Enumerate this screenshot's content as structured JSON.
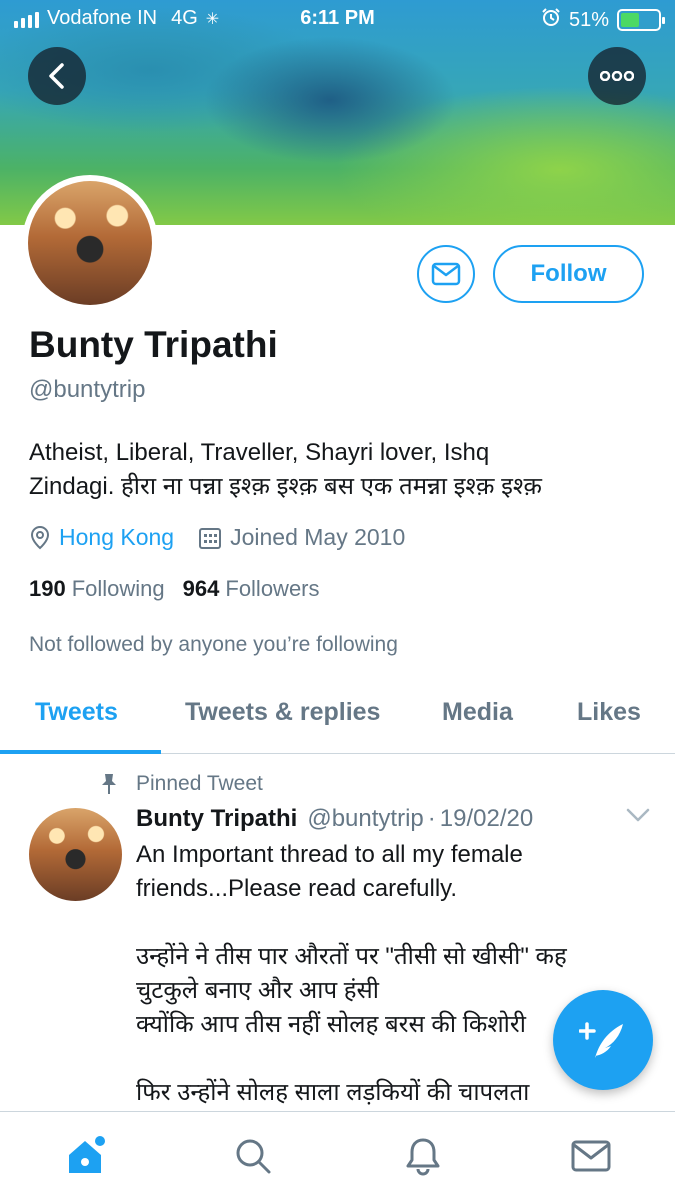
{
  "status_bar": {
    "carrier": "Vodafone IN",
    "network": "4G",
    "time": "6:11 PM",
    "battery": "51%",
    "battery_level": 0.51
  },
  "profile": {
    "name": "Bunty Tripathi",
    "handle": "@buntytrip",
    "bio_line1": "Atheist, Liberal, Traveller, Shayri lover, Ishq",
    "bio_line2": "Zindagi. हीरा ना पन्ना इश्क़ इश्क़ बस एक तमन्ना इश्क़ इश्क़",
    "location": "Hong Kong",
    "joined": "Joined May 2010",
    "following_count": "190",
    "following_label": "Following",
    "followers_count": "964",
    "followers_label": "Followers",
    "not_followed": "Not followed by anyone you’re following",
    "follow_label": "Follow"
  },
  "tabs": [
    {
      "label": "Tweets",
      "active": true
    },
    {
      "label": "Tweets & replies",
      "active": false
    },
    {
      "label": "Media",
      "active": false
    },
    {
      "label": "Likes",
      "active": false
    }
  ],
  "pinned_tweet": {
    "pinned_label": "Pinned Tweet",
    "name": "Bunty Tripathi",
    "handle": "@buntytrip",
    "separator": "·",
    "date": "19/02/20",
    "lines": [
      "An Important thread to all my female",
      "friends...Please read carefully.",
      "",
      "उन्होंने ने तीस पार औरतों पर \"तीसी सो खीसी\" कह",
      "चुटकुले बनाए और आप हंसी",
      "क्योंकि आप तीस नहीं सोलह बरस की किशोरी",
      "",
      "फिर उन्होंने सोलह साला लड़कियों की चापलता"
    ]
  },
  "colors": {
    "accent": "#1da1f2",
    "secondary_text": "#657786",
    "primary_text": "#14171a"
  },
  "icons": {
    "back": "chevron-left-icon",
    "more": "more-horizontal-icon",
    "message": "envelope-icon",
    "location": "location-pin-icon",
    "calendar": "calendar-icon",
    "pin": "pin-icon",
    "compose": "compose-tweet-icon",
    "nav_home": "home-icon",
    "nav_search": "search-icon",
    "nav_notifications": "bell-icon",
    "nav_messages": "envelope-icon"
  }
}
